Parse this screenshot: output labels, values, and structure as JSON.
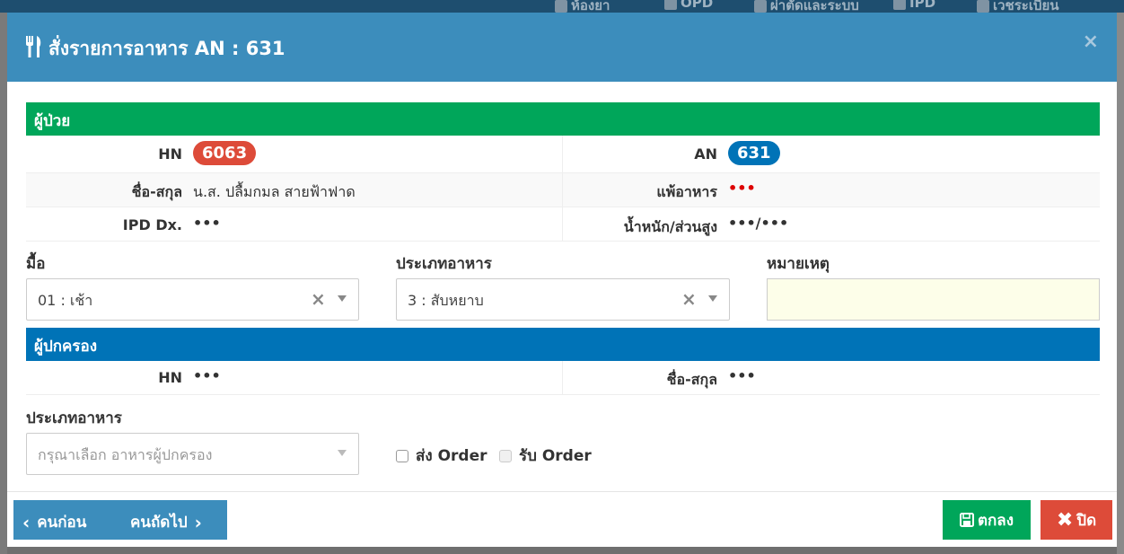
{
  "background_nav": {
    "items": [
      "ห้องยา",
      "OPD",
      "ผ่าตัดและระบบ",
      "IPD",
      "เวชระเบียน"
    ]
  },
  "modal": {
    "title": "สั่งรายการอาหาร AN : 631",
    "close_glyph": "×",
    "patient_section": {
      "heading": "ผู้ป่วย",
      "hn_label": "HN",
      "hn_value": "6063",
      "an_label": "AN",
      "an_value": "631",
      "name_label": "ชื่อ-สกุล",
      "name_value": "น.ส. ปลื้มกมล สายฟ้าฟาด",
      "allergy_label": "แพ้อาหาร",
      "allergy_value": "•••",
      "dx_label": "IPD Dx.",
      "dx_value": "•••",
      "weight_label": "น้ำหนัก/ส่วนสูง",
      "weight_value": "•••/•••"
    },
    "meal": {
      "label": "มื้อ",
      "selected": "01 : เช้า"
    },
    "food_type": {
      "label": "ประเภทอาหาร",
      "selected": "3 : สับหยาบ"
    },
    "note": {
      "label": "หมายเหตุ",
      "value": ""
    },
    "guardian_section": {
      "heading": "ผู้ปกครอง",
      "hn_label": "HN",
      "hn_value": "•••",
      "name_label": "ชื่อ-สกุล",
      "name_value": "•••"
    },
    "guardian_food": {
      "label": "ประเภทอาหาร",
      "placeholder": "กรุณาเลือก อาหารผู้ปกครอง"
    },
    "send_order": {
      "label": "ส่ง Order",
      "checked": false
    },
    "receive_order": {
      "label": "รับ Order",
      "checked": false,
      "disabled": true
    },
    "footer": {
      "prev_label": "คนก่อน",
      "next_label": "คนถัดไป",
      "ok_label": "ตกลง",
      "close_label": "ปิด"
    }
  },
  "colors": {
    "header": "#3c8dbc",
    "patient_heading": "#00a65a",
    "guardian_heading": "#0073b7",
    "hn_badge": "#dd4b39",
    "an_badge": "#0073b7",
    "ok_button": "#00a65a",
    "close_button": "#dd4b39",
    "note_bg": "#fdfee9"
  }
}
